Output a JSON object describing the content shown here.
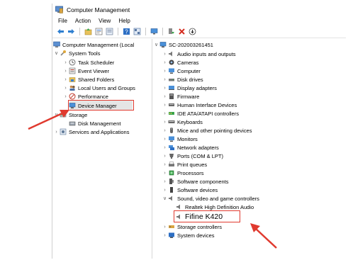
{
  "window": {
    "title": "Computer Management"
  },
  "menu": [
    "File",
    "Action",
    "View",
    "Help"
  ],
  "toolbar_icons": [
    "back-icon",
    "forward-icon",
    "up-folder-icon",
    "properties-icon",
    "list-icon",
    "help-icon",
    "grid-icon",
    "monitor-icon",
    "enable-device-icon",
    "remove-icon",
    "update-driver-icon"
  ],
  "left_tree": {
    "root": "Computer Management (Local",
    "system_tools": "System Tools",
    "task_scheduler": "Task Scheduler",
    "event_viewer": "Event Viewer",
    "shared_folders": "Shared Folders",
    "local_users": "Local Users and Groups",
    "performance": "Performance",
    "device_manager": "Device Manager",
    "storage": "Storage",
    "disk_management": "Disk Management",
    "services": "Services and Applications"
  },
  "right_tree": {
    "computer_name": "SC-202003261451",
    "categories": [
      "Audio inputs and outputs",
      "Cameras",
      "Computer",
      "Disk drives",
      "Display adapters",
      "Firmware",
      "Human Interface Devices",
      "IDE ATA/ATAPI controllers",
      "Keyboards",
      "Mice and other pointing devices",
      "Monitors",
      "Network adapters",
      "Ports (COM & LPT)",
      "Print queues",
      "Processors",
      "Software components",
      "Software devices",
      "Sound, video and game controllers"
    ],
    "sound_children": [
      "Realtek High Definition Audio",
      "Fifine K420"
    ],
    "after": [
      "Storage controllers",
      "System devices"
    ]
  },
  "colors": {
    "highlight": "#e03a2f",
    "arrow": "#e03a2f"
  }
}
